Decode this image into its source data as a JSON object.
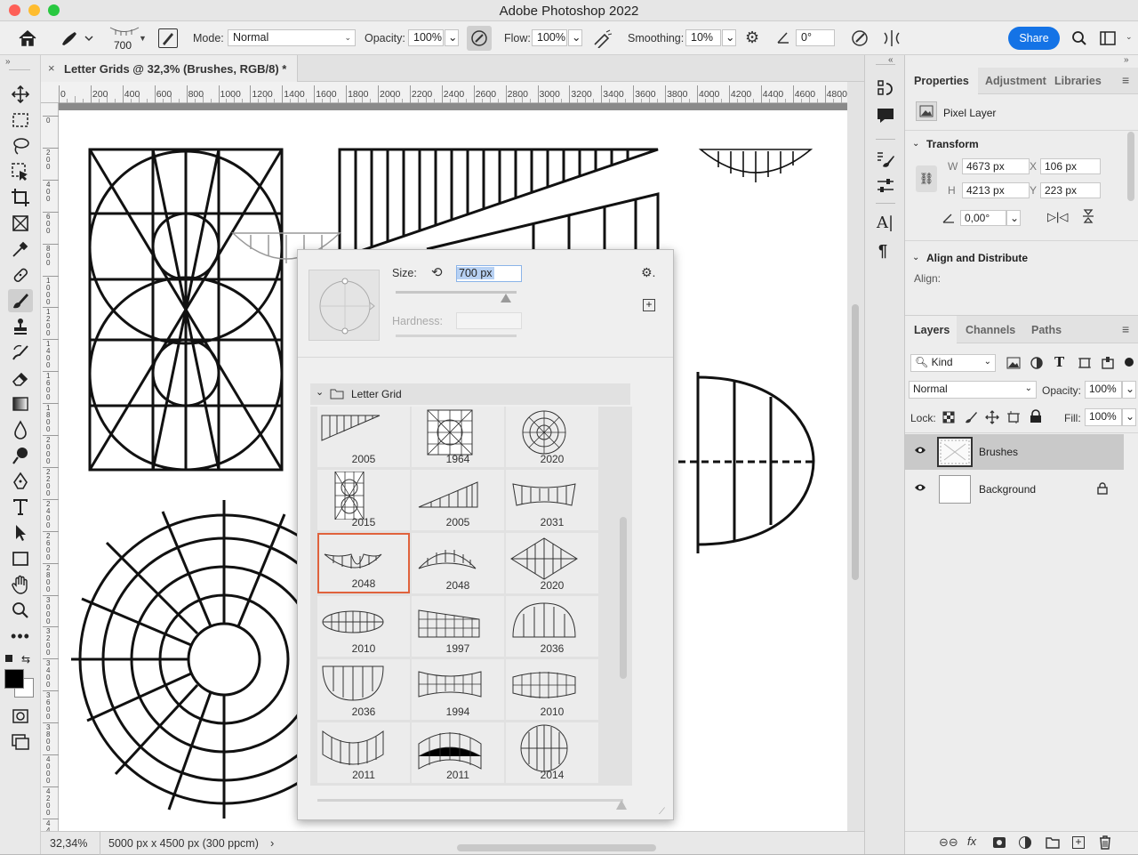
{
  "window": {
    "title": "Adobe Photoshop 2022"
  },
  "options_bar": {
    "brush_size": "700",
    "mode_label": "Mode:",
    "mode_value": "Normal",
    "opacity_label": "Opacity:",
    "opacity_value": "100%",
    "flow_label": "Flow:",
    "flow_value": "100%",
    "smoothing_label": "Smoothing:",
    "smoothing_value": "10%",
    "angle_value": "0°",
    "share_label": "Share"
  },
  "document": {
    "tab_title": "Letter Grids @ 32,3% (Brushes, RGB/8) *",
    "ruler_top": [
      "0",
      "200",
      "400",
      "600",
      "800",
      "1000",
      "1200",
      "1400",
      "1600",
      "1800",
      "2000",
      "2200",
      "2400",
      "2600",
      "2800",
      "3000",
      "3200",
      "3400",
      "3600",
      "3800",
      "4000",
      "4200",
      "4400",
      "4600",
      "4800"
    ],
    "ruler_left": [
      "0",
      "2 0 0",
      "4 0 0",
      "6 0 0",
      "8 0 0",
      "1 0 0 0",
      "1 2 0 0",
      "1 4 0 0",
      "1 6 0 0",
      "1 8 0 0",
      "2 0 0 0",
      "2 2 0 0",
      "2 4 0 0",
      "2 6 0 0",
      "2 8 0 0",
      "3 0 0 0",
      "3 2 0 0",
      "3 4 0 0",
      "3 6 0 0",
      "3 8 0 0",
      "4 0 0 0",
      "4 2 0 0",
      "4 4 0 0"
    ]
  },
  "status": {
    "zoom": "32,34%",
    "doc_info": "5000 px x 4500 px (300 ppcm)"
  },
  "brush_popup": {
    "size_label": "Size:",
    "size_value": "700 px",
    "hardness_label": "Hardness:",
    "group_name": "Letter Grid",
    "brushes": [
      {
        "num": "2005",
        "icon": "wedge-brush"
      },
      {
        "num": "1964",
        "icon": "square-grid-brush"
      },
      {
        "num": "2020",
        "icon": "radial-grid-brush"
      },
      {
        "num": "2015",
        "icon": "tall-grid-brush"
      },
      {
        "num": "2005",
        "icon": "ramp-brush"
      },
      {
        "num": "2031",
        "icon": "bowtie-brush"
      },
      {
        "num": "2048",
        "icon": "smile-brush",
        "selected": true
      },
      {
        "num": "2048",
        "icon": "arch-brush"
      },
      {
        "num": "2020",
        "icon": "diamond-brush"
      },
      {
        "num": "2010",
        "icon": "ellipse-brush"
      },
      {
        "num": "1997",
        "icon": "slope-brush"
      },
      {
        "num": "2036",
        "icon": "dome-brush"
      },
      {
        "num": "2036",
        "icon": "bowl-brush"
      },
      {
        "num": "1994",
        "icon": "pinch-brush"
      },
      {
        "num": "2010",
        "icon": "bulge-brush"
      },
      {
        "num": "2011",
        "icon": "curve-brush"
      },
      {
        "num": "2011",
        "icon": "hump-brush"
      },
      {
        "num": "2014",
        "icon": "circle-grid-brush"
      }
    ]
  },
  "properties": {
    "tabs": [
      "Properties",
      "Adjustment:",
      "Libraries"
    ],
    "kind": "Pixel Layer",
    "transform_title": "Transform",
    "w_label": "W",
    "w_value": "4673 px",
    "h_label": "H",
    "h_value": "4213 px",
    "x_label": "X",
    "x_value": "106 px",
    "y_label": "Y",
    "y_value": "223 px",
    "angle_value": "0,00°",
    "align_title": "Align and Distribute",
    "align_label": "Align:"
  },
  "layers": {
    "tabs": [
      "Layers",
      "Channels",
      "Paths"
    ],
    "kind_filter": "Kind",
    "blend_mode": "Normal",
    "opacity_label": "Opacity:",
    "opacity_value": "100%",
    "lock_label": "Lock:",
    "fill_label": "Fill:",
    "fill_value": "100%",
    "items": [
      {
        "name": "Brushes",
        "selected": true
      },
      {
        "name": "Background",
        "locked": true
      }
    ]
  },
  "colors": {
    "accent": "#1473e6",
    "selection": "#e0623c"
  }
}
